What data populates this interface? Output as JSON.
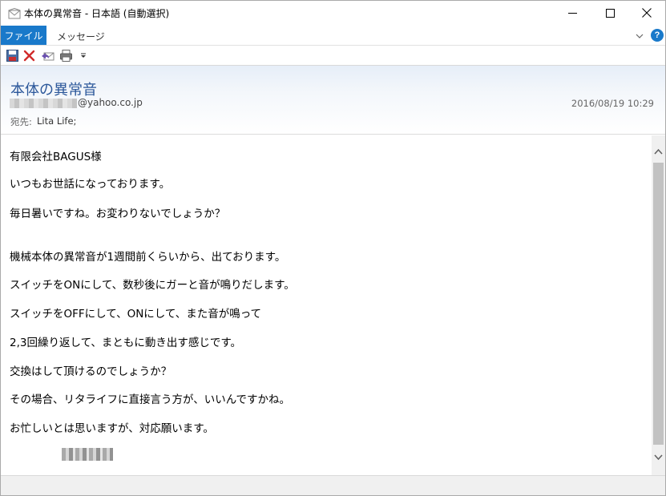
{
  "window": {
    "title": "本体の異常音 - 日本語 (自動選択)"
  },
  "ribbon": {
    "tab_file": "ファイル",
    "tab_message": "メッセージ",
    "help_label": "?"
  },
  "email": {
    "subject": "本体の異常音",
    "sender_visible": "@yahoo.co.jp",
    "date": "2016/08/19 10:29",
    "to_label": "宛先:",
    "to_value": "Lita Life;"
  },
  "body": {
    "lines": [
      "有限会社BAGUS様",
      "いつもお世話になっております。",
      "毎日暑いですね。お変わりないでしょうか？",
      "機械本体の異常音が1週間前くらいから、出ております。",
      "スイッチをONにして、数秒後にガーと音が鳴りだします。",
      "スイッチをOFFにして、ONにして、また音が鳴って",
      "2,3回繰り返して、まともに動き出す感じです。",
      "交換はして頂けるのでしょうか？",
      "その場合、リタライフに直接言う方が、いいんですかね。",
      "お忙しいとは思いますが、対応願います。"
    ]
  },
  "icons": {
    "app": "envelope-icon",
    "minimize": "minimize-icon",
    "maximize": "maximize-icon",
    "close": "close-icon",
    "qat": [
      "save-icon",
      "delete-icon",
      "reply-icon",
      "print-icon",
      "customize-dropdown-icon"
    ],
    "scroll_up": "chevron-up-icon",
    "scroll_down": "chevron-down-icon"
  },
  "colors": {
    "accent": "#1979ca",
    "subject": "#2b579a"
  }
}
